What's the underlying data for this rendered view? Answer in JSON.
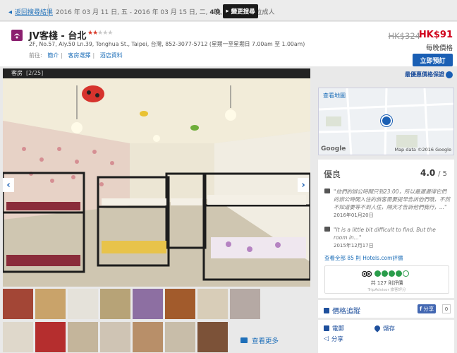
{
  "topbar": {
    "back_label": "返回搜尋結果",
    "search_summary": "2016 年 03 月 11 日, 五 - 2016 年 03 月 15 日, 二, ",
    "nights": "4晚",
    "guests": ", 1間客房, 1位成人",
    "change_label": "變更搜尋"
  },
  "hotel": {
    "name": "JV客棧 - 台北",
    "star_rating": 2,
    "address": "2F, No.57, Aly.50 Ln.39, Tonghua St., Taipei, 台灣, 852-3077-5712 (星期一至星期日 7.00am 至 1.00am)",
    "nav_label": "前往:",
    "nav_links": [
      "簡介",
      "客房選擇",
      "酒店資料"
    ]
  },
  "pricing": {
    "old_price": "HK$324",
    "new_price": "HK$91",
    "per_night": "每晚價格",
    "book_label": "立即預訂",
    "best_price_label": "最優惠價格保證"
  },
  "photo": {
    "label": "客房",
    "counter": "[2/25]"
  },
  "more_photos_label": "查看更多",
  "map": {
    "title": "查看地圖",
    "logo": "Google",
    "copyright": "Map data ©2016 Google"
  },
  "reviews": {
    "rating_word": "優良",
    "score": "4.0",
    "score_max": "/ 5",
    "items": [
      {
        "text": "\"他們的辦公時間只到23:00，所以最遲遲得它們的辦公時間入住的旅客需要提早告訴他們哦，不然不知道要等不到人住，隔天才告訴他們我行，...\"",
        "date": "2016年01月20日"
      },
      {
        "text": "\"It is a little bit difficult to find. But the room in...\"",
        "date": "2015年12月17日"
      }
    ],
    "all_reviews_label": "查看全部 85 則 Hotels.com評價",
    "tripadvisor_count": "共 127 則評價",
    "tripadvisor_label": "TripAdvisor 旅客評分"
  },
  "tracking": {
    "label": "價格追蹤",
    "share_label": "分享",
    "share_count": "0"
  },
  "actions": {
    "email": "電郵",
    "save": "儲存",
    "share": "分享"
  },
  "colors": {
    "accent": "#1a5fb4",
    "sale_price": "#d0021b",
    "rating_green": "#2a9d4b"
  }
}
